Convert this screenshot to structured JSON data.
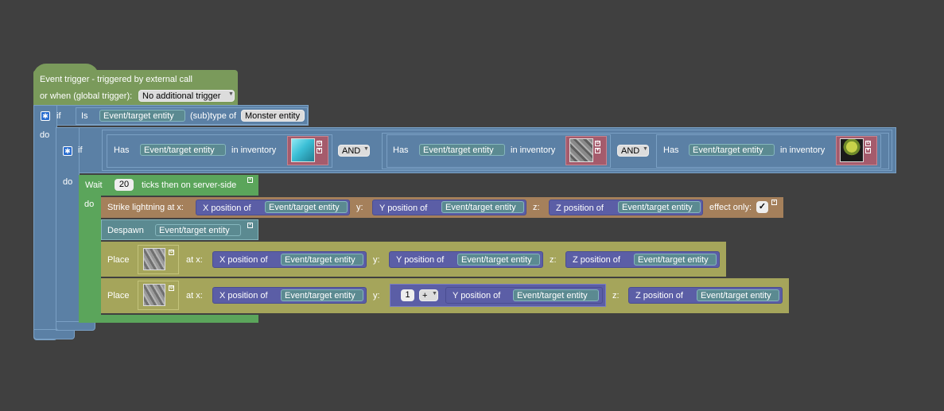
{
  "trigger": {
    "title": "Event trigger - triggered by external call",
    "or_when_label": "or when (global trigger):",
    "global_trigger_value": "No additional trigger"
  },
  "outer_if": {
    "if_label": "if",
    "do_label": "do",
    "is_label": "Is",
    "entity": "Event/target entity",
    "subtype_label": "(sub)type of",
    "type_value": "Monster entity"
  },
  "inner_if": {
    "if_label": "if",
    "do_label": "do",
    "conditions": [
      {
        "has_label": "Has",
        "entity": "Event/target entity",
        "inventory_label": "in inventory",
        "item_icon": "diamond-block-icon",
        "item_color": "#3bbfd6"
      },
      {
        "has_label": "Has",
        "entity": "Event/target entity",
        "inventory_label": "in inventory",
        "item_icon": "stone-ore-block-icon",
        "item_color": "#7a7a7a"
      },
      {
        "has_label": "Has",
        "entity": "Event/target entity",
        "inventory_label": "in inventory",
        "item_icon": "sapling-icon",
        "item_color": "#9c8a2e"
      }
    ],
    "and_labels": [
      "AND",
      "AND"
    ]
  },
  "wait": {
    "label": "Wait",
    "ticks": "20",
    "suffix": "ticks then on server-side",
    "do_label": "do"
  },
  "strike": {
    "label": "Strike lightning at x:",
    "x_label": "X position of",
    "y_sep": "y:",
    "y_label": "Y position of",
    "z_sep": "z:",
    "z_label": "Z position of",
    "entity": "Event/target entity",
    "effect_label": "effect only:",
    "effect_check": "✓"
  },
  "despawn": {
    "label": "Despawn",
    "entity": "Event/target entity"
  },
  "place1": {
    "label": "Place",
    "at_x": "at x:",
    "x_label": "X position of",
    "y_sep": "y:",
    "y_label": "Y position of",
    "z_sep": "z:",
    "z_label": "Z position of",
    "entity": "Event/target entity",
    "block_icon": "stone-block-icon"
  },
  "place2": {
    "label": "Place",
    "at_x": "at x:",
    "x_label": "X position of",
    "y_sep": "y:",
    "num": "1",
    "op": "+",
    "y_label": "Y position of",
    "z_sep": "z:",
    "z_label": "Z position of",
    "entity": "Event/target entity",
    "block_icon": "stone-block-icon"
  },
  "colors": {
    "workspace": "#404040",
    "trigger_block": "#7a9a5b",
    "logic_block": "#5b80a5",
    "control_block": "#5ba55b",
    "world_block": "#a5805b",
    "entity_block": "#5b8a91",
    "position_block": "#5b5ea6",
    "place_block": "#a5a55b",
    "item_block": "#a55b6c"
  }
}
